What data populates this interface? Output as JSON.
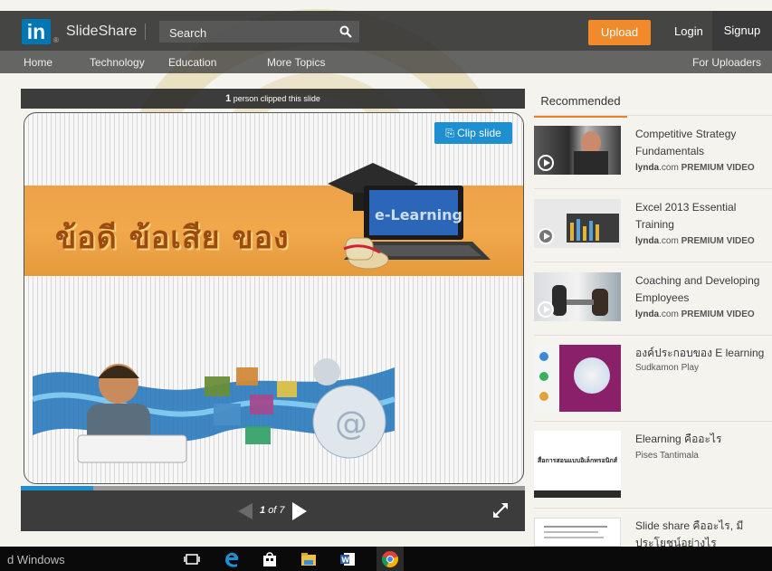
{
  "header": {
    "logo_text": "in",
    "logo_reg": "®",
    "brand": "SlideShare",
    "search_placeholder": "Search",
    "upload_label": "Upload",
    "login_label": "Login",
    "signup_label": "Signup"
  },
  "nav": {
    "items": [
      "Home",
      "Technology",
      "Education",
      "More Topics"
    ],
    "right": "For Uploaders"
  },
  "viewer": {
    "clipped_count": "1",
    "clipped_text": "person clipped this slide",
    "clip_label": "Clip slide",
    "slide_title_thai": "ข้อดี ข้อเสีย ของ",
    "laptop_banner_text": "e-Learning",
    "page_current": "1",
    "page_total_text": "of 7",
    "progress_fraction": 0.143
  },
  "sidebar": {
    "tab_label": "Recommended",
    "items": [
      {
        "title": "Competitive Strategy Fundamentals",
        "source_a": "lynda",
        "source_b": ".com",
        "tag": "PREMIUM VIDEO",
        "video": true
      },
      {
        "title": "Excel 2013 Essential Training",
        "source_a": "lynda",
        "source_b": ".com",
        "tag": "PREMIUM VIDEO",
        "video": true
      },
      {
        "title": "Coaching and Developing Employees",
        "source_a": "lynda",
        "source_b": ".com",
        "tag": "PREMIUM VIDEO",
        "video": true
      },
      {
        "title": "องค์ประกอบของ E learning",
        "author": "Sudkamon Play"
      },
      {
        "title": "Elearning คืออะไร",
        "author": "Pises Tantimala",
        "thumb_text": "สื่อการสอนแบบอิเล็กทรอนิกส์"
      },
      {
        "title": "Slide share คืออะไร, มีประโยชน์อย่างไร"
      }
    ]
  },
  "taskbar": {
    "text": "d Windows"
  },
  "colors": {
    "accent_orange": "#f18a2a",
    "linkedin_blue": "#0077b5",
    "clip_blue": "#1e8fd0"
  }
}
